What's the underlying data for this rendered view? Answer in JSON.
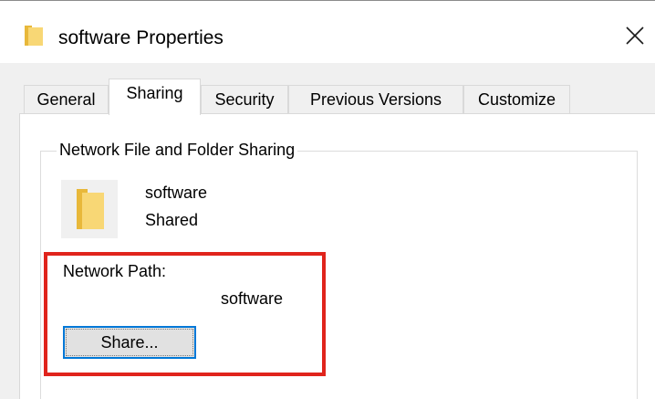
{
  "window": {
    "title": "software Properties",
    "title_icon": "folder-icon",
    "close_glyph": "✕"
  },
  "tabs": [
    {
      "label": "General",
      "active": false
    },
    {
      "label": "Sharing",
      "active": true
    },
    {
      "label": "Security",
      "active": false
    },
    {
      "label": "Previous Versions",
      "active": false
    },
    {
      "label": "Customize",
      "active": false
    }
  ],
  "sharing": {
    "group_title": "Network File and Folder Sharing",
    "folder_name": "software",
    "folder_status": "Shared",
    "folder_icon": "folder-icon",
    "network_path_label": "Network Path:",
    "network_path_value": "software",
    "share_button_label": "Share..."
  },
  "colors": {
    "highlight": "#e0241c",
    "focus_border": "#0078d7",
    "folder_yellow": "#f8d775"
  }
}
